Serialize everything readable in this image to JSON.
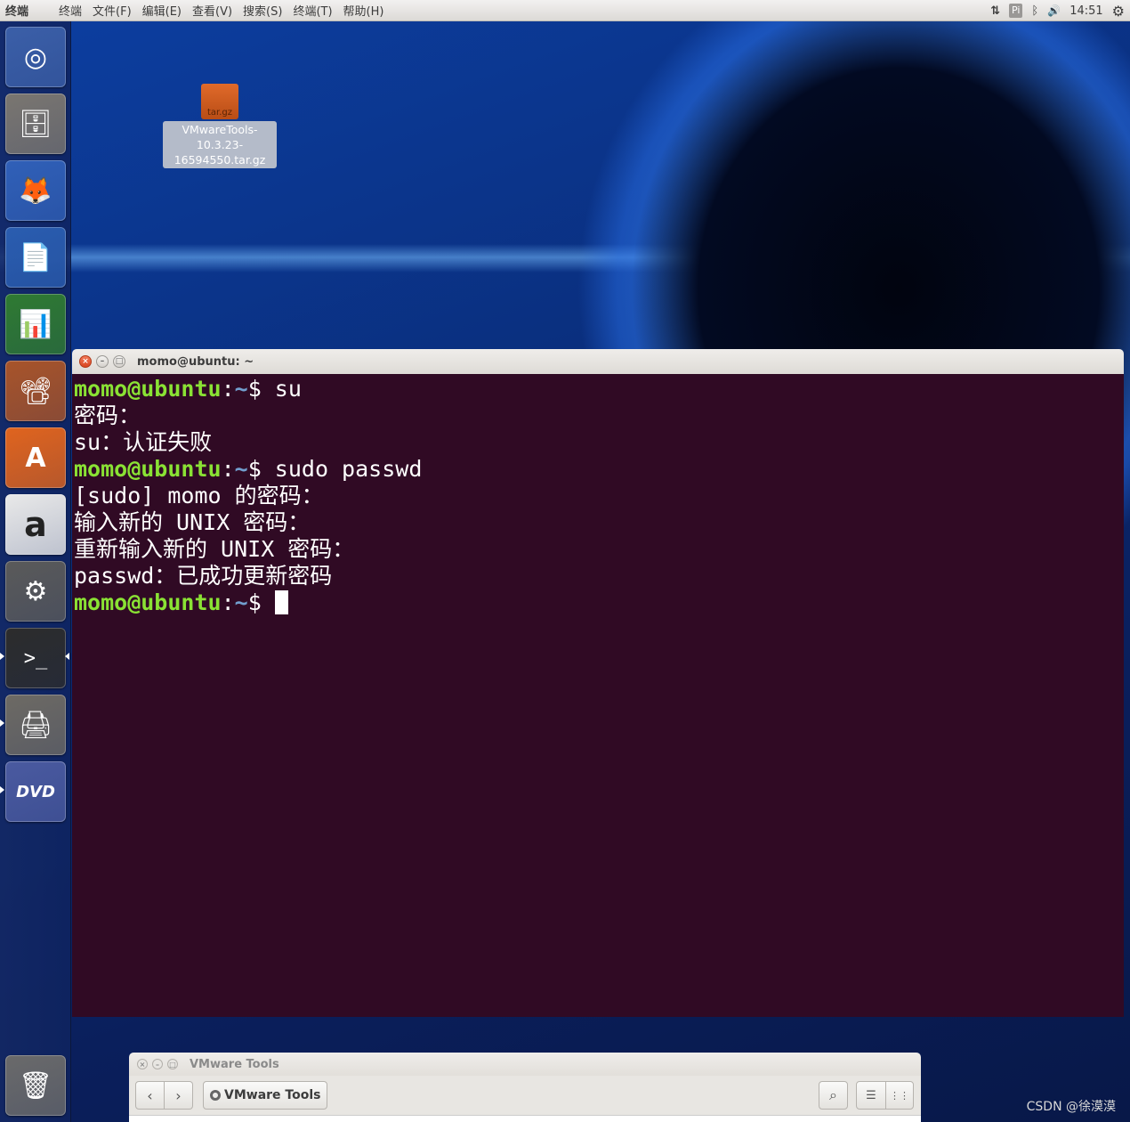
{
  "top_panel": {
    "app_title": "终端",
    "menus": [
      "终端",
      "文件(F)",
      "编辑(E)",
      "查看(V)",
      "搜索(S)",
      "终端(T)",
      "帮助(H)"
    ],
    "indicators": {
      "network": "⇅",
      "input_method": "Pi",
      "bluetooth": "ᛒ",
      "volume": "🔊",
      "time": "14:51",
      "settings": "⚙"
    }
  },
  "launcher": {
    "items": [
      {
        "name": "dash",
        "glyph": "◎",
        "color": "#3b5fa8"
      },
      {
        "name": "files",
        "glyph": "🗄",
        "color": "#7a7670"
      },
      {
        "name": "firefox",
        "glyph": "🦊",
        "color": "#3060b8"
      },
      {
        "name": "writer",
        "glyph": "📄",
        "color": "#2a5db0"
      },
      {
        "name": "calc",
        "glyph": "📊",
        "color": "#2f7a32"
      },
      {
        "name": "impress",
        "glyph": "📽",
        "color": "#a8542a"
      },
      {
        "name": "software",
        "glyph": "A",
        "color": "#e0641e"
      },
      {
        "name": "amazon",
        "glyph": "a",
        "color": "#e9e9e9"
      },
      {
        "name": "system-settings",
        "glyph": "⚙",
        "color": "#5a5a5a"
      },
      {
        "name": "terminal",
        "glyph": ">_",
        "color": "#2c2c2c"
      },
      {
        "name": "printer",
        "glyph": "🖨",
        "color": "#6d6a64"
      },
      {
        "name": "dvd",
        "glyph": "DVD",
        "color": "#4a5aa0"
      },
      {
        "name": "trash",
        "glyph": "🗑",
        "color": "#6a6a6a"
      }
    ]
  },
  "desktop": {
    "file": {
      "badge": "tar.gz",
      "name": "VMwareTools-10.3.23-16594550.tar.gz"
    }
  },
  "terminal": {
    "title": "momo@ubuntu: ~",
    "buttons": {
      "close": "×",
      "minimize": "–",
      "maximize": "□"
    },
    "lines": [
      {
        "user": "momo@ubuntu",
        "sep": ":",
        "path": "~",
        "rest": "$ su"
      },
      {
        "text": "密码："
      },
      {
        "text": "su：认证失败"
      },
      {
        "user": "momo@ubuntu",
        "sep": ":",
        "path": "~",
        "rest": "$ sudo passwd"
      },
      {
        "text": "[sudo] momo 的密码："
      },
      {
        "text": "输入新的 UNIX 密码："
      },
      {
        "text": "重新输入新的 UNIX 密码："
      },
      {
        "text": "passwd：已成功更新密码"
      },
      {
        "user": "momo@ubuntu",
        "sep": ":",
        "path": "~",
        "rest": "$ "
      }
    ]
  },
  "file_manager": {
    "title": "VMware Tools",
    "buttons": {
      "close": "×",
      "minimize": "–",
      "maximize": "□"
    },
    "back": "‹",
    "forward": "›",
    "location": "VMware Tools",
    "search_icon": "⌕",
    "list_view": "☰",
    "grid_view": "⋮⋮"
  },
  "watermark": "CSDN @徐漠漠"
}
